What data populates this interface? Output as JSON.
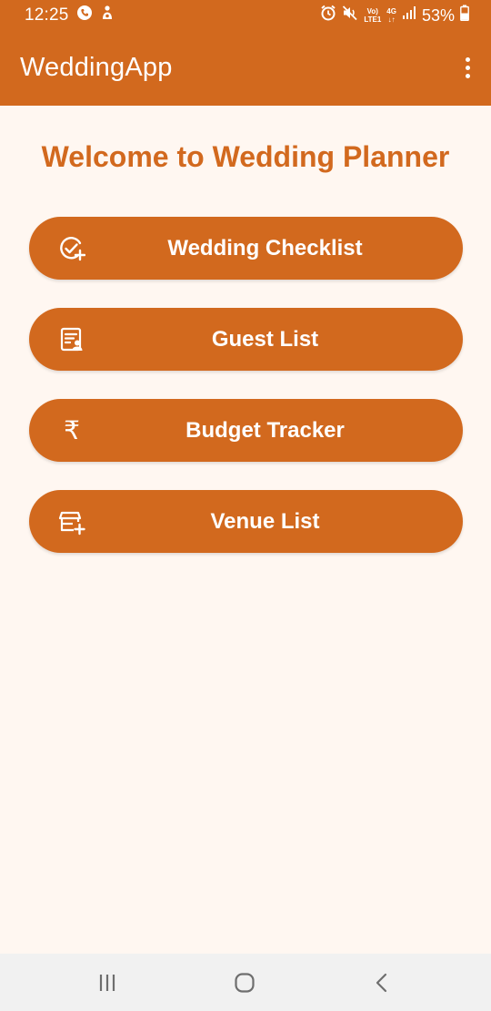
{
  "status_bar": {
    "time": "12:25",
    "battery": "53%",
    "network_top": "Vo)",
    "network_bottom": "LTE1",
    "signal_type": "4G",
    "icons": [
      "phone-call-icon",
      "app-notification-icon",
      "alarm-icon",
      "mute-icon",
      "volte-icon",
      "signal-icon",
      "battery-icon"
    ]
  },
  "app_bar": {
    "title": "WeddingApp",
    "menu_icon": "overflow-menu-icon"
  },
  "main": {
    "heading": "Welcome to Wedding Planner",
    "buttons": [
      {
        "label": "Wedding Checklist",
        "icon": "checklist-add-icon"
      },
      {
        "label": "Guest List",
        "icon": "guest-list-icon"
      },
      {
        "label": "Budget Tracker",
        "icon": "rupee-icon",
        "glyph": "₹"
      },
      {
        "label": "Venue List",
        "icon": "venue-add-icon"
      }
    ]
  },
  "nav_bar": {
    "items": [
      "recent-apps-icon",
      "home-icon",
      "back-icon"
    ]
  },
  "colors": {
    "primary": "#D2691E",
    "background": "#FFF7F1",
    "on_primary": "#FFFFFF",
    "nav_bar": "#F1F1F1",
    "nav_icon": "#6E6E6E"
  }
}
